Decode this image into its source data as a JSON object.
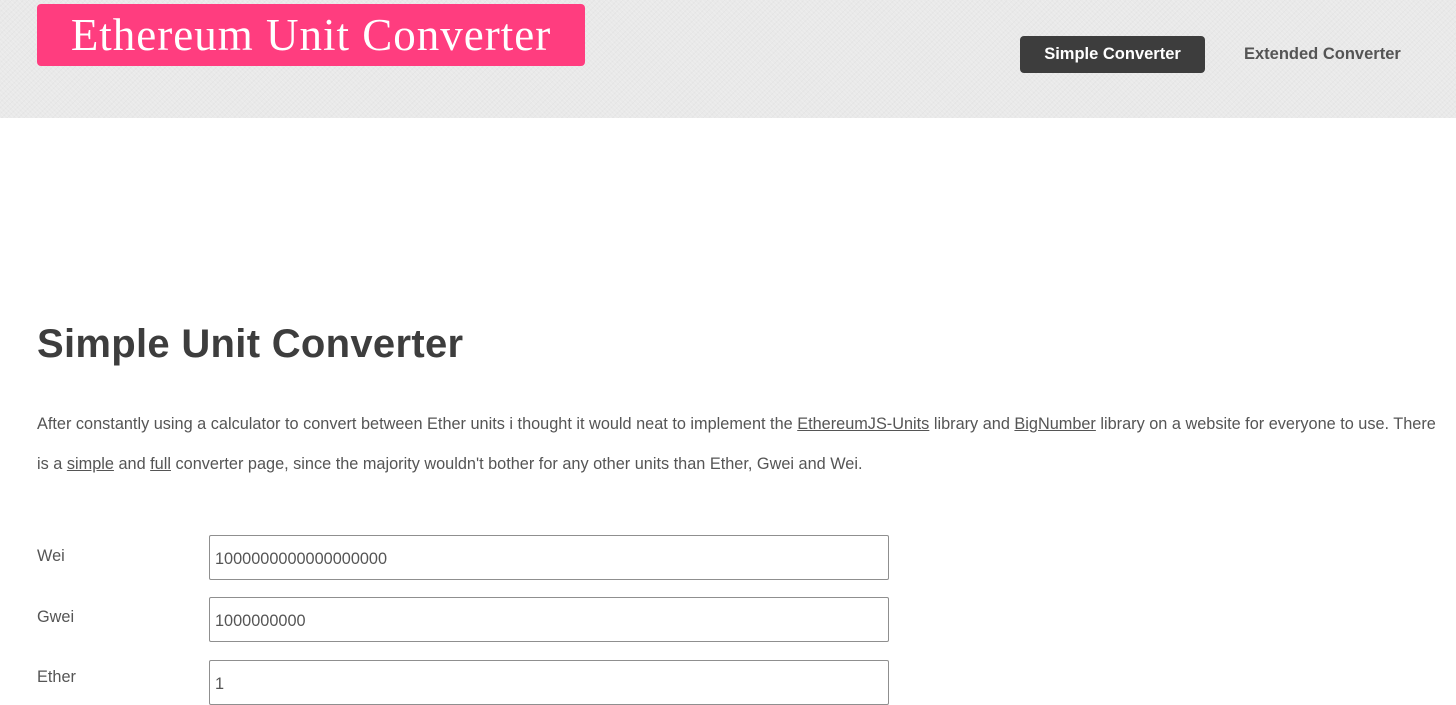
{
  "header": {
    "logo_text": "Ethereum Unit Converter",
    "nav": {
      "simple": "Simple Converter",
      "extended": "Extended Converter"
    }
  },
  "main": {
    "title": "Simple Unit Converter",
    "intro": {
      "part1": "After constantly using a calculator to convert between Ether units i thought it would neat to implement the ",
      "link1": "EthereumJS-Units",
      "part2": " library and ",
      "link2": "BigNumber",
      "part3": " library on a website for everyone to use. There is a ",
      "link3": "simple",
      "part4": " and ",
      "link4": "full",
      "part5": " converter page, since the majority wouldn't bother for any other units than Ether, Gwei and Wei."
    },
    "converter": {
      "rows": [
        {
          "label": "Wei",
          "value": "1000000000000000000"
        },
        {
          "label": "Gwei",
          "value": "1000000000"
        },
        {
          "label": "Ether",
          "value": "1"
        }
      ]
    }
  },
  "colors": {
    "brand": "#ff3d7f",
    "nav_active_bg": "#3d3d3d",
    "text": "#555555",
    "header_bg": "#e9e9e9"
  }
}
